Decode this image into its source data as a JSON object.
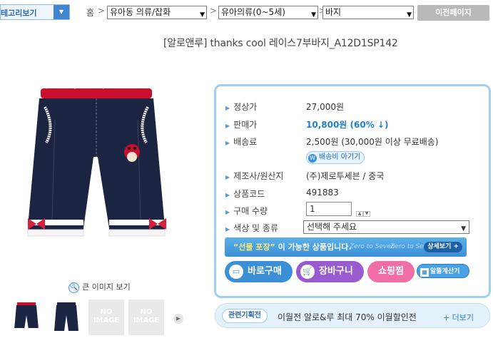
{
  "nav": {
    "category_button": "테고리보기",
    "home": "홈",
    "separators": [
      ">",
      ">",
      ">"
    ],
    "category1": "유아동 의류/잡화",
    "category2": "유아의류(0~5세)",
    "category3": "바지",
    "prev_page": "이전페이지"
  },
  "product": {
    "title": "[알로앤루] thanks cool 레이스7부바지_A12D1SP142",
    "zoom_label": "큰 이미지 보기",
    "no_image": "NO IMAGE"
  },
  "info": {
    "list_price_label": "정상가",
    "list_price": "27,000원",
    "sale_price_label": "판매가",
    "sale_price": "10,800원 (60% ↓)",
    "shipping_label": "배송료",
    "shipping": "2,500원 (30,000원 이상 무료배송)",
    "shipping_story_button": "배송비 아기기",
    "maker_label": "제조사/원산지",
    "maker": "(주)제로투세븐 / 중국",
    "code_label": "상품코드",
    "code": "491883",
    "qty_label": "구매 수량",
    "qty": "1",
    "option_label": "색상 및 종류",
    "option": "선택해 주세요",
    "gift_quote": "“선물 포장”",
    "gift_text": "이 가능한 상품입니다.",
    "gift_watermark": "Zero to Seven",
    "gift_detail": "상세보기 +",
    "buy_now": "바로구매",
    "cart": "장바구니",
    "shopping": "쇼핑찜",
    "calculator": "알뜰계산기"
  },
  "related": {
    "tag": "관련기획전",
    "text": "이월전 알로&루 최대 70% 이월할인전",
    "more": "+ 더보기"
  },
  "colors": {
    "accent_blue": "#3a8fd6",
    "sale_blue": "#1e7fd0",
    "border_blue": "#9ed0ef",
    "cart_purple": "#9a5ad0",
    "wishlist_pink": "#f06ea5"
  }
}
